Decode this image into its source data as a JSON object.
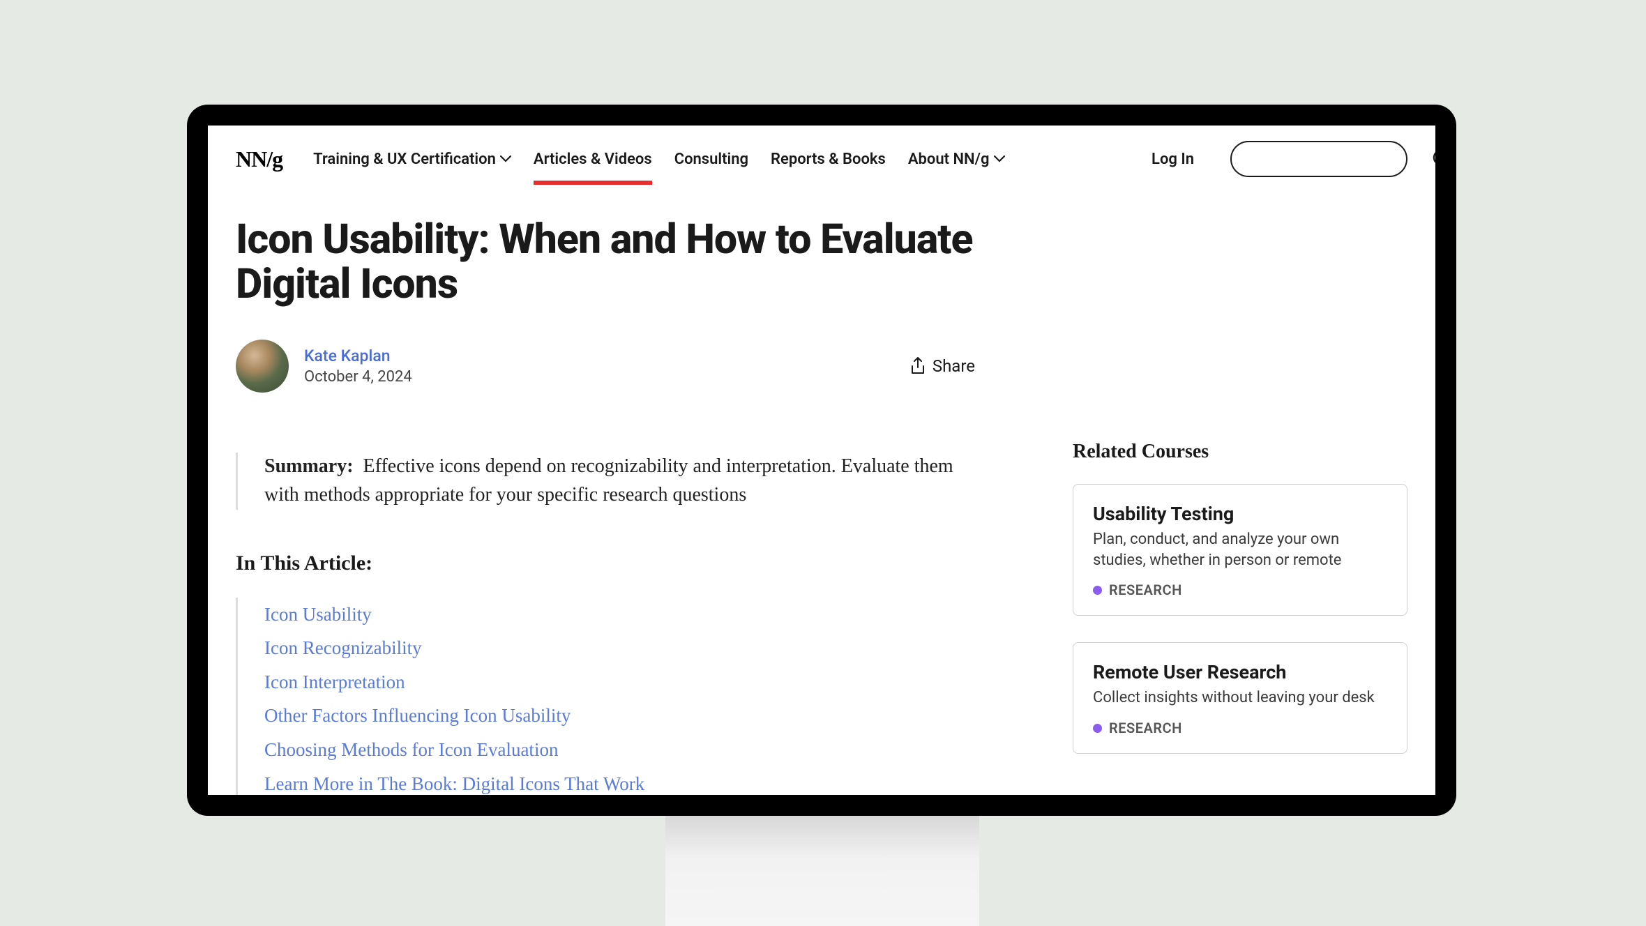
{
  "logo": "NN/g",
  "nav": {
    "training": "Training & UX Certification",
    "articles": "Articles & Videos",
    "consulting": "Consulting",
    "reports": "Reports & Books",
    "about": "About NN/g",
    "login": "Log In"
  },
  "article": {
    "title": "Icon Usability: When and How to Evaluate Digital Icons",
    "author": "Kate Kaplan",
    "date": "October 4, 2024",
    "share_label": "Share",
    "summary_label": "Summary:",
    "summary_text": "Effective icons depend on recognizability and interpretation. Evaluate them with methods appropriate for your specific research questions",
    "toc_heading": "In This Article:",
    "toc": [
      "Icon Usability",
      "Icon Recognizability",
      "Icon Interpretation",
      "Other Factors Influencing Icon Usability",
      "Choosing Methods for Icon Evaluation",
      "Learn More in The Book: Digital Icons That Work"
    ]
  },
  "sidebar": {
    "heading": "Related Courses",
    "courses": [
      {
        "title": "Usability Testing",
        "desc": "Plan, conduct, and analyze your own studies, whether in person or remote",
        "tag": "RESEARCH"
      },
      {
        "title": "Remote User Research",
        "desc": "Collect insights without leaving your desk",
        "tag": "RESEARCH"
      }
    ]
  }
}
